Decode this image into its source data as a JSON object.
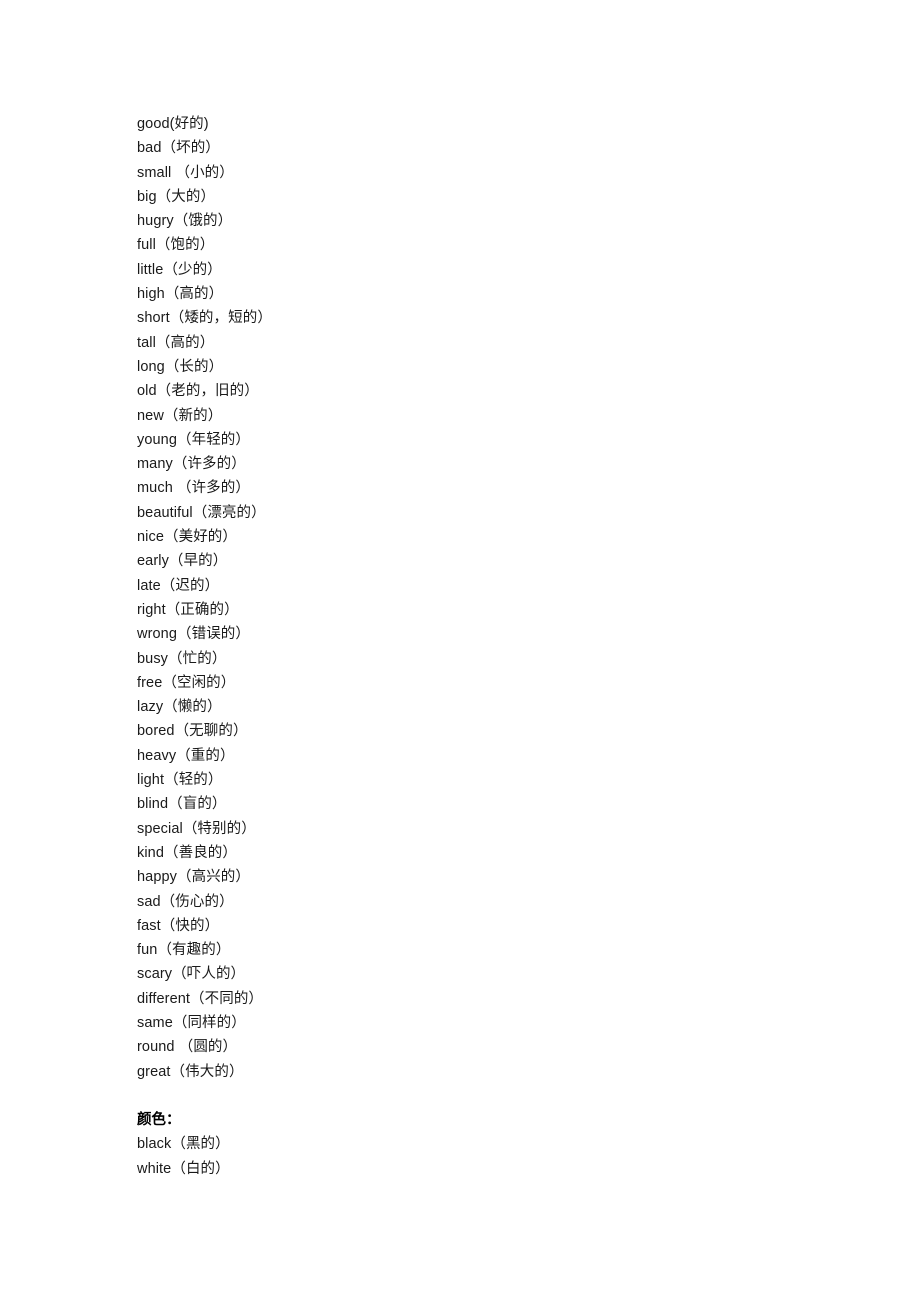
{
  "document": {
    "background_color": "#ffffff",
    "text_color": "#1a1a1a",
    "sections": [
      {
        "heading": null,
        "entries": [
          "good(好的)",
          "bad（坏的）",
          "small （小的）",
          "big（大的）",
          "hugry（饿的）",
          "full（饱的）",
          "little（少的）",
          "high（高的）",
          "short（矮的，短的）",
          "tall（高的）",
          "long（长的）",
          "old（老的，旧的）",
          "new（新的）",
          "young（年轻的）",
          "many（许多的）",
          "much （许多的）",
          "beautiful（漂亮的）",
          "nice（美好的）",
          "early（早的）",
          "late（迟的）",
          "right（正确的）",
          "wrong（错误的）",
          "busy（忙的）",
          "free（空闲的）",
          "lazy（懒的）",
          "bored（无聊的）",
          "heavy（重的）",
          "light（轻的）",
          "blind（盲的）",
          "special（特别的）",
          "kind（善良的）",
          "happy（高兴的）",
          "sad（伤心的）",
          "fast（快的）",
          "fun（有趣的）",
          "scary（吓人的）",
          "different（不同的）",
          "same（同样的）",
          "round （圆的）",
          "great（伟大的）"
        ]
      },
      {
        "heading": "颜色：",
        "entries": [
          "black（黑的）",
          "white（白的）"
        ]
      }
    ]
  }
}
